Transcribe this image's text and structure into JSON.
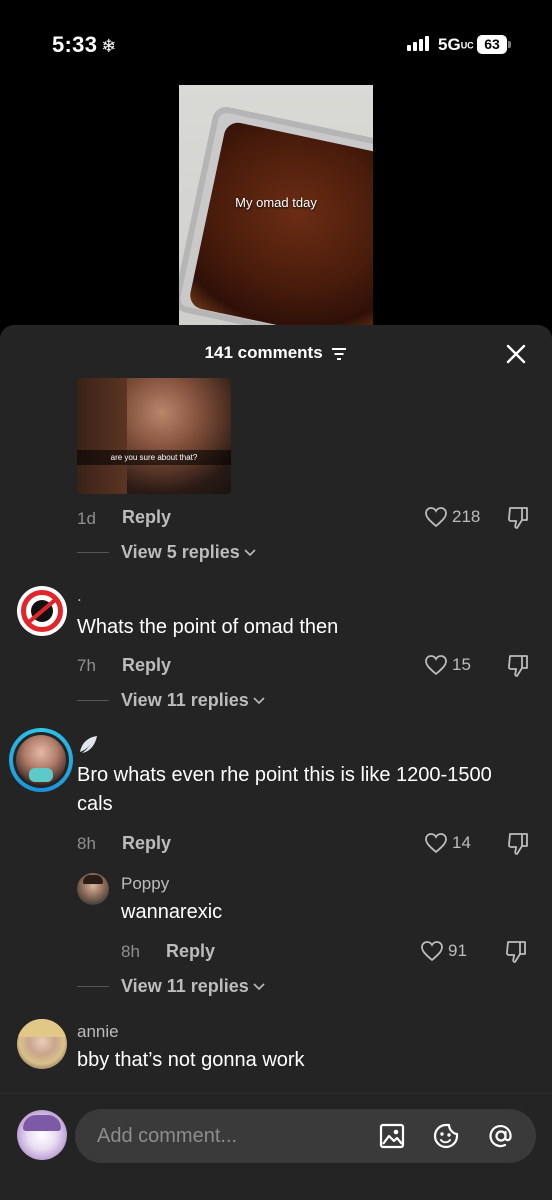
{
  "status_bar": {
    "time": "5:33",
    "network": "5G",
    "network_suffix": "UC",
    "battery": "63"
  },
  "video": {
    "overlay_text": "My omad tday"
  },
  "comments_sheet": {
    "title": "141 comments",
    "comments": [
      {
        "attachment_caption": "are you sure about that?",
        "age": "1d",
        "reply_label": "Reply",
        "likes": "218",
        "view_replies": "View 5 replies"
      },
      {
        "username": ".",
        "text": "Whats the point of omad then",
        "age": "7h",
        "reply_label": "Reply",
        "likes": "15",
        "view_replies": "View 11 replies"
      },
      {
        "username": "",
        "text_line1": "Bro whats even rhe point this is like 1200-1500",
        "text_line2": "cals",
        "age": "8h",
        "reply_label": "Reply",
        "likes": "14",
        "nested_reply": {
          "username": "Poppy",
          "text": "wannarexic",
          "age": "8h",
          "reply_label": "Reply",
          "likes": "91"
        },
        "view_replies": "View 11 replies"
      },
      {
        "username": "annie",
        "text": "bby that’s not gonna work"
      }
    ]
  },
  "input_bar": {
    "placeholder": "Add comment..."
  },
  "colors": {
    "sheet_bg": "#242424",
    "input_bg": "#3a3a3a",
    "muted_text": "#8f8f8f"
  }
}
